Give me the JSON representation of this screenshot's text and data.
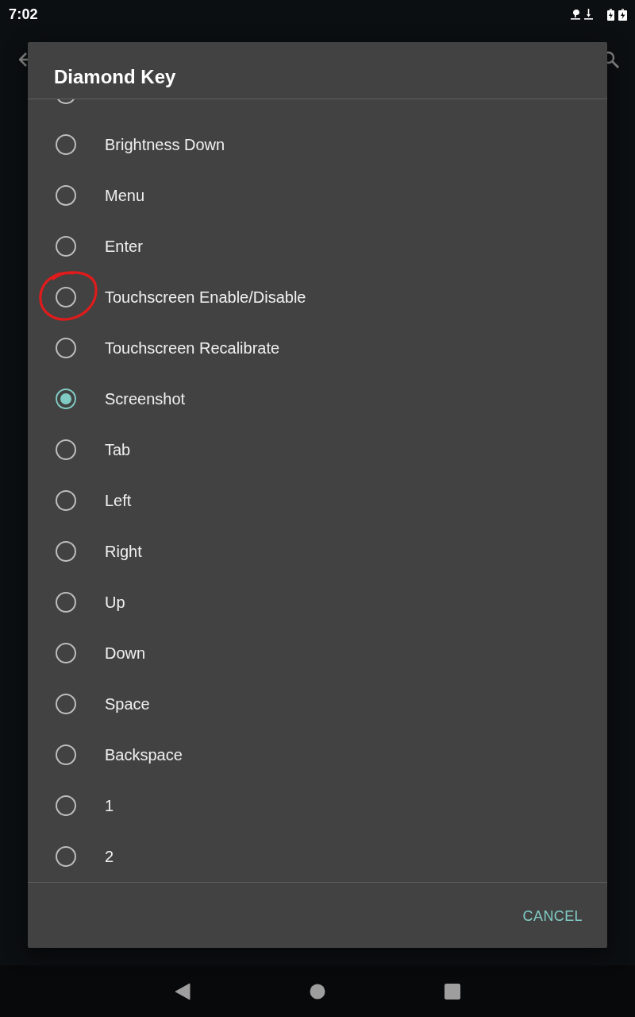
{
  "status_bar": {
    "time": "7:02"
  },
  "dialog": {
    "title": "Diamond Key",
    "options": [
      {
        "selected": false,
        "highlighted": false
      },
      {
        "label": "Brightness Down",
        "selected": false,
        "highlighted": false
      },
      {
        "label": "Menu",
        "selected": false,
        "highlighted": false
      },
      {
        "label": "Enter",
        "selected": false,
        "highlighted": false
      },
      {
        "label": "Touchscreen Enable/Disable",
        "selected": false,
        "highlighted": true
      },
      {
        "label": "Touchscreen Recalibrate",
        "selected": false,
        "highlighted": false
      },
      {
        "label": "Screenshot",
        "selected": true,
        "highlighted": false
      },
      {
        "label": "Tab",
        "selected": false,
        "highlighted": false
      },
      {
        "label": "Left",
        "selected": false,
        "highlighted": false
      },
      {
        "label": "Right",
        "selected": false,
        "highlighted": false
      },
      {
        "label": "Up",
        "selected": false,
        "highlighted": false
      },
      {
        "label": "Down",
        "selected": false,
        "highlighted": false
      },
      {
        "label": "Space",
        "selected": false,
        "highlighted": false
      },
      {
        "label": "Backspace",
        "selected": false,
        "highlighted": false
      },
      {
        "label": "1",
        "selected": false,
        "highlighted": false
      },
      {
        "label": "2",
        "selected": false,
        "highlighted": false
      }
    ],
    "buttons": [
      {
        "label": "CANCEL"
      }
    ]
  }
}
